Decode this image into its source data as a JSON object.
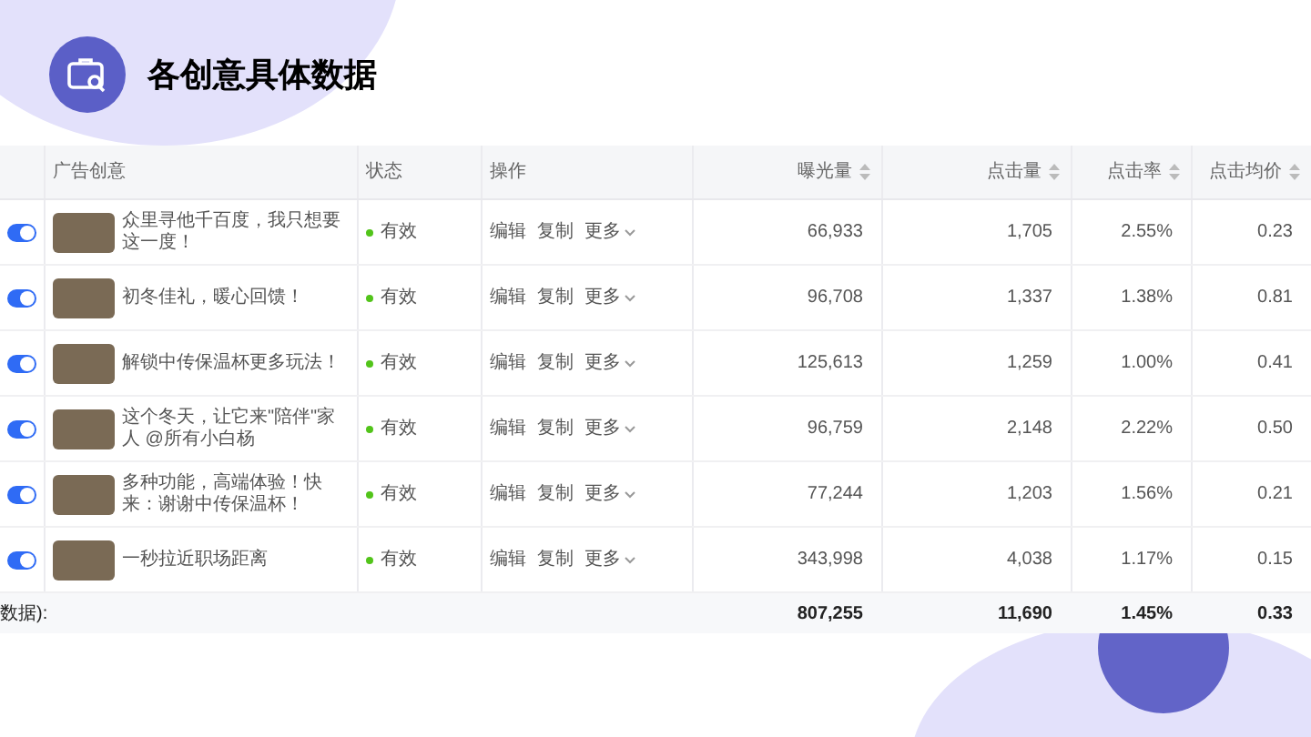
{
  "title": "各创意具体数据",
  "table": {
    "columns": [
      {
        "label": "广告创意",
        "sortable": false
      },
      {
        "label": "状态",
        "sortable": false
      },
      {
        "label": "操作",
        "sortable": false
      },
      {
        "label": "曝光量",
        "sortable": true
      },
      {
        "label": "点击量",
        "sortable": true
      },
      {
        "label": "点击率",
        "sortable": true
      },
      {
        "label": "点击均价",
        "sortable": true
      }
    ],
    "rows": [
      {
        "on": true,
        "creative": "众里寻他千百度，我只想要这一度！",
        "status": "有效",
        "color": "#52c41a",
        "actions": [
          "编辑",
          "复制",
          "更多"
        ],
        "impressions": "66,933",
        "clicks": "1,705",
        "ctr": "2.55%",
        "cpc": "0.23"
      },
      {
        "on": true,
        "creative": "初冬佳礼，暖心回馈！",
        "status": "有效",
        "color": "#52c41a",
        "actions": [
          "编辑",
          "复制",
          "更多"
        ],
        "impressions": "96,708",
        "clicks": "1,337",
        "ctr": "1.38%",
        "cpc": "0.81"
      },
      {
        "on": true,
        "creative": "解锁中传保温杯更多玩法！",
        "status": "有效",
        "color": "#52c41a",
        "actions": [
          "编辑",
          "复制",
          "更多"
        ],
        "impressions": "125,613",
        "clicks": "1,259",
        "ctr": "1.00%",
        "cpc": "0.41"
      },
      {
        "on": true,
        "creative": "这个冬天，让它来\"陪伴\"家人 @所有小白杨",
        "status": "有效",
        "color": "#52c41a",
        "actions": [
          "编辑",
          "复制",
          "更多"
        ],
        "impressions": "96,759",
        "clicks": "2,148",
        "ctr": "2.22%",
        "cpc": "0.50"
      },
      {
        "on": true,
        "creative": "多种功能，高端体验！快来：谢谢中传保温杯！",
        "status": "有效",
        "color": "#52c41a",
        "actions": [
          "编辑",
          "复制",
          "更多"
        ],
        "impressions": "77,244",
        "clicks": "1,203",
        "ctr": "1.56%",
        "cpc": "0.21"
      },
      {
        "on": true,
        "creative": "一秒拉近职场距离",
        "status": "有效",
        "color": "#52c41a",
        "actions": [
          "编辑",
          "复制",
          "更多"
        ],
        "impressions": "343,998",
        "clicks": "4,038",
        "ctr": "1.17%",
        "cpc": "0.15"
      }
    ],
    "footer": {
      "label": "数据):",
      "impressions": "807,255",
      "clicks": "11,690",
      "ctr": "1.45%",
      "cpc": "0.33"
    }
  }
}
